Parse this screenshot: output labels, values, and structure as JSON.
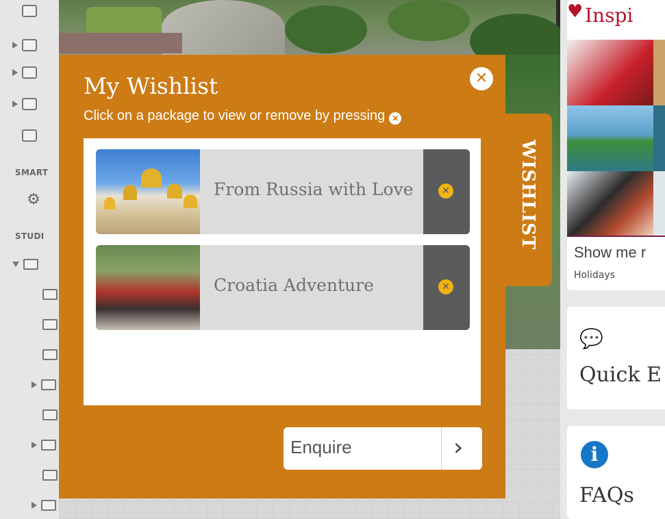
{
  "sidebar": {
    "section_smart": "SMART",
    "section_studio": "STUDI"
  },
  "wishlist": {
    "title": "My Wishlist",
    "subtitle": "Click on a package to view or remove by pressing",
    "tab_label": "WISHLIST",
    "close_icon": "close-icon",
    "packages": [
      {
        "name": "From Russia with Love"
      },
      {
        "name": "Croatia Adventure"
      }
    ],
    "enquire_label": "Enquire",
    "enquire_icon": "chevron-right-icon",
    "accent_color": "#cc7b15"
  },
  "right_panel": {
    "inspire_title": "Inspi",
    "show_me": "Show me r",
    "holidays": "Holidays",
    "quick_title": "Quick E",
    "faq_title": "FAQs",
    "faq_icon_glyph": "i"
  }
}
